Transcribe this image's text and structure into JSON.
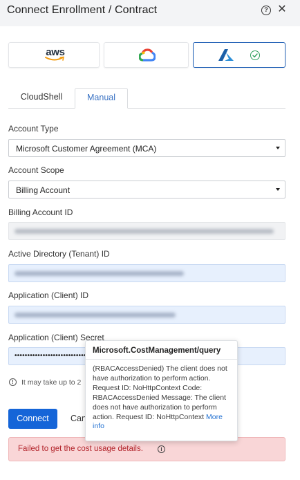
{
  "dialog": {
    "title": "Connect Enrollment / Contract",
    "help_icon": "?",
    "close_icon": "✕"
  },
  "providers": [
    {
      "name": "aws",
      "logo_text": "aws",
      "selected": false
    },
    {
      "name": "gcp",
      "icon": "google-cloud-icon",
      "selected": false
    },
    {
      "name": "azure",
      "icon": "azure-icon",
      "selected": true,
      "status_icon": "check-circle-icon"
    }
  ],
  "tabs": [
    {
      "label": "CloudShell",
      "active": false
    },
    {
      "label": "Manual",
      "active": true
    }
  ],
  "form": {
    "account_type": {
      "label": "Account Type",
      "value": "Microsoft Customer Agreement (MCA)"
    },
    "account_scope": {
      "label": "Account Scope",
      "value": "Billing Account"
    },
    "billing_account_id": {
      "label": "Billing Account ID"
    },
    "tenant_id": {
      "label": "Active Directory (Tenant) ID"
    },
    "client_id": {
      "label": "Application (Client) ID"
    },
    "client_secret": {
      "label": "Application (Client) Secret",
      "value": "•••••••••••••••••••••••••••••••••••••••"
    }
  },
  "note": {
    "text": "It may take up to 2"
  },
  "buttons": {
    "connect": "Connect",
    "cancel": "Cancel"
  },
  "error": {
    "message": "Failed to get the cost usage details."
  },
  "tooltip": {
    "title": "Microsoft.CostManagement/query",
    "body": "(RBACAccessDenied) The client does not have authorization to perform action. Request ID: NoHttpContext Code: RBACAccessDenied Message: The client does not have authorization to perform action. Request ID: NoHttpContext",
    "link": "More info"
  },
  "colors": {
    "primary": "#1565d8",
    "error_bg": "#f9d6d7",
    "error_text": "#b3262d",
    "success": "#2f9e5b"
  }
}
